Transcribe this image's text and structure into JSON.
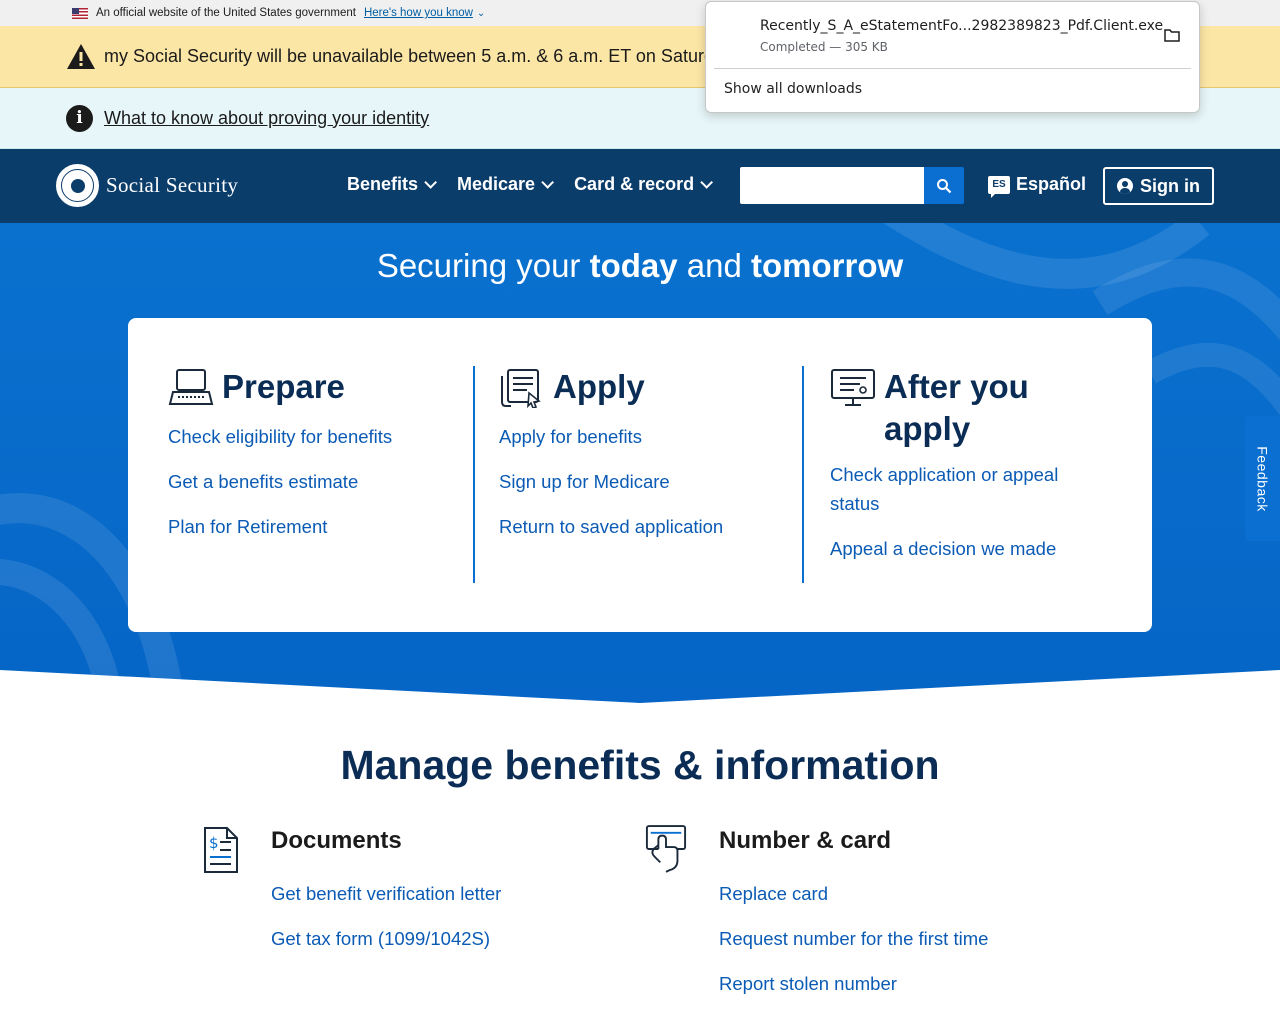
{
  "gov_banner": {
    "text": "An official website of the United States government",
    "link": "Here's how you know"
  },
  "alert": {
    "text": "my Social Security will be unavailable between 5 a.m. & 6 a.m. ET on Saturday."
  },
  "info": {
    "link": "What to know about proving your identity"
  },
  "header": {
    "logo_text": "Social Security",
    "nav": [
      "Benefits",
      "Medicare",
      "Card & record"
    ],
    "search_placeholder": "",
    "espanol_badge": "ES",
    "espanol": "Español",
    "signin": "Sign in"
  },
  "hero": {
    "title_part1": "Securing your ",
    "title_bold1": "today",
    "title_part2": " and ",
    "title_bold2": "tomorrow"
  },
  "columns": [
    {
      "title": "Prepare",
      "icon": "laptop-icon",
      "links": [
        "Check eligibility for benefits",
        "Get a benefits estimate",
        "Plan for Retirement"
      ]
    },
    {
      "title": "Apply",
      "icon": "document-pointer-icon",
      "links": [
        "Apply for benefits",
        "Sign up for Medicare",
        "Return to saved application"
      ]
    },
    {
      "title_line1": "After you",
      "title_line2": "apply",
      "icon": "monitor-icon",
      "links": [
        "Check application or appeal",
        "status",
        "Appeal a decision we made"
      ]
    }
  ],
  "feedback": "Feedback",
  "manage": {
    "title": "Manage benefits & information",
    "documents": {
      "title": "Documents",
      "icon": "dollar-document-icon",
      "links": [
        "Get benefit verification letter",
        "Get tax form (1099/1042S)"
      ]
    },
    "number_card": {
      "title": "Number & card",
      "icon": "hand-card-icon",
      "links": [
        "Replace card",
        "Request number for the first time",
        "Report stolen number"
      ]
    }
  },
  "download_popup": {
    "filename": "Recently_S_A_eStatementFo...2982389823_Pdf.Client.exe",
    "status": "Completed — 305 KB",
    "show_all": "Show all downloads"
  }
}
